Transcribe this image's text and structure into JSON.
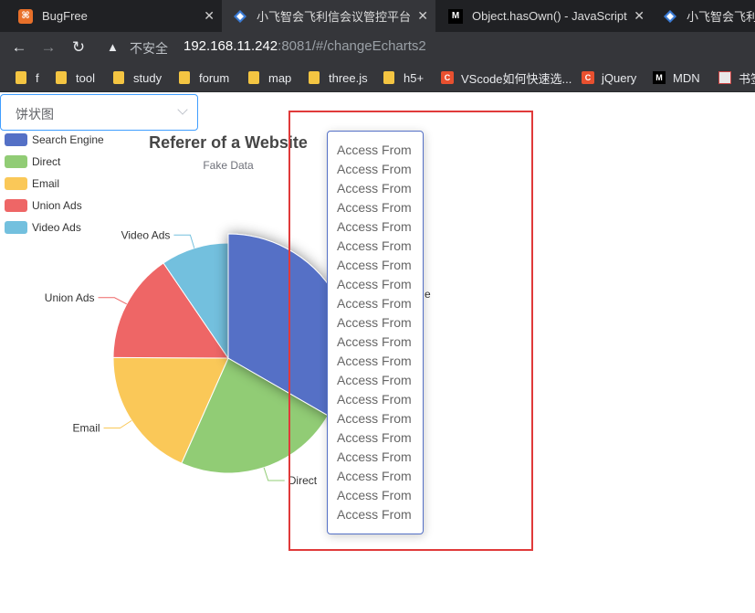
{
  "tabs": [
    {
      "title": "BugFree",
      "favicon": "bugfree-icon",
      "active": false
    },
    {
      "title": "小飞智会飞利信会议管控平台",
      "favicon": "app-diamond-icon",
      "active": true
    },
    {
      "title": "Object.hasOwn() - JavaScript | ",
      "favicon": "mdn-icon",
      "active": false
    },
    {
      "title": "小飞智会飞利信",
      "favicon": "app-diamond-icon",
      "active": false
    }
  ],
  "address": {
    "insecure_label": "不安全",
    "host": "192.168.11.242",
    "rest": ":8081/#/changeEcharts2"
  },
  "bookmarks": [
    {
      "label": "f",
      "type": "folder"
    },
    {
      "label": "tool",
      "type": "folder"
    },
    {
      "label": "study",
      "type": "folder"
    },
    {
      "label": "forum",
      "type": "folder"
    },
    {
      "label": "map",
      "type": "folder"
    },
    {
      "label": "three.js",
      "type": "folder"
    },
    {
      "label": "h5+",
      "type": "folder"
    },
    {
      "label": "VScode如何快速选...",
      "type": "csdn"
    },
    {
      "label": "jQuery",
      "type": "csdn"
    },
    {
      "label": "MDN",
      "type": "mdn"
    },
    {
      "label": "书签",
      "type": "doc"
    }
  ],
  "select": {
    "value": "饼状图"
  },
  "colors": {
    "accent": "#409eff",
    "highlight_box": "#e03a3a"
  },
  "chart_data": {
    "type": "pie",
    "title": "Referer of a Website",
    "subtitle": "Fake Data",
    "legend": [
      "Search Engine",
      "Direct",
      "Email",
      "Union Ads",
      "Video Ads"
    ],
    "legend_position": "top-left",
    "series": [
      {
        "name": "Search Engine",
        "value": 1048,
        "color": "#5470c6"
      },
      {
        "name": "Direct",
        "value": 735,
        "color": "#91cc75"
      },
      {
        "name": "Email",
        "value": 580,
        "color": "#fac858"
      },
      {
        "name": "Union Ads",
        "value": 484,
        "color": "#ee6666"
      },
      {
        "name": "Video Ads",
        "value": 300,
        "color": "#73c0de"
      }
    ],
    "visible_slice_labels": [
      "Video Ads",
      "Union Ads",
      "Email",
      "Direct"
    ],
    "partial_label_fragment": "e"
  },
  "tooltip": {
    "lines": [
      "Access From",
      "Access From",
      "Access From",
      "Access From",
      "Access From",
      "Access From",
      "Access From",
      "Access From",
      "Access From",
      "Access From",
      "Access From",
      "Access From",
      "Access From",
      "Access From",
      "Access From",
      "Access From",
      "Access From",
      "Access From",
      "Access From",
      "Access From"
    ]
  }
}
